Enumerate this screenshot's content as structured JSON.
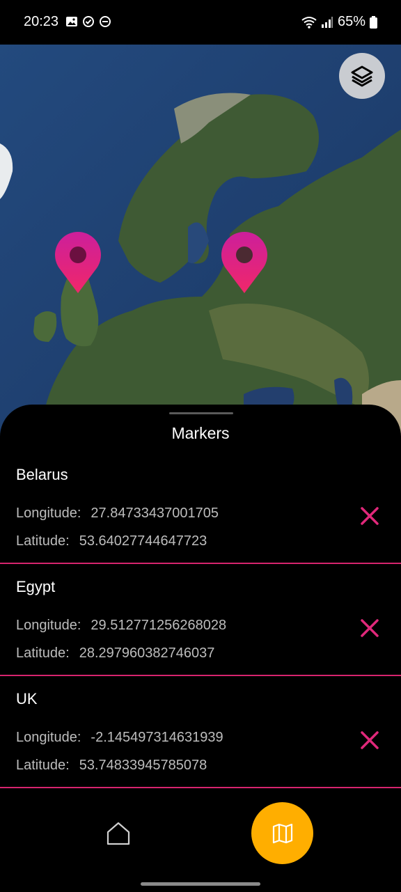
{
  "status_bar": {
    "time": "20:23",
    "battery": "65%",
    "icons": [
      "image-icon",
      "sync-check-icon",
      "dnd-icon",
      "wifi-icon",
      "signal-icon",
      "battery-icon"
    ]
  },
  "map": {
    "layers_icon": "layers-icon",
    "marker_color": "#e0287a",
    "markers": [
      "uk-marker",
      "belarus-marker"
    ]
  },
  "sheet": {
    "title": "Markers",
    "longitude_label": "Longitude:",
    "latitude_label": "Latitude:",
    "items": [
      {
        "name": "Belarus",
        "longitude": "27.84733437001705",
        "latitude": "53.64027744647723"
      },
      {
        "name": "Egypt",
        "longitude": "29.512771256268028",
        "latitude": "28.297960382746037"
      },
      {
        "name": "UK",
        "longitude": "-2.145497314631939",
        "latitude": "53.74833945785078"
      }
    ],
    "delete_icon": "close-icon",
    "accent": "#d6246e"
  },
  "nav": {
    "home_icon": "home-icon",
    "map_icon": "map-icon",
    "active_color": "#ffae00"
  }
}
